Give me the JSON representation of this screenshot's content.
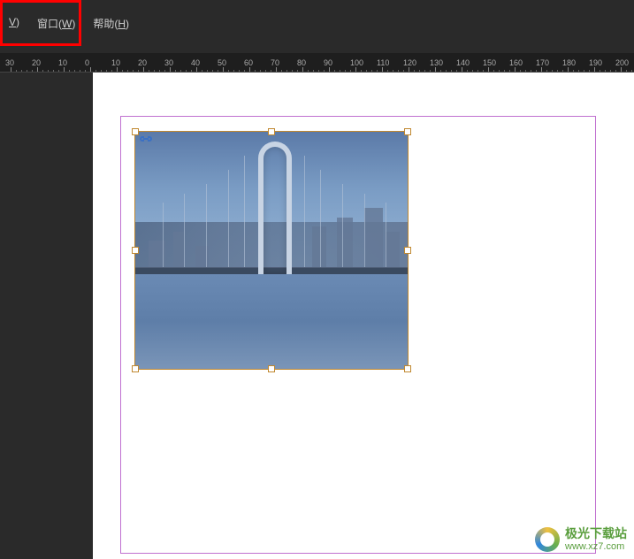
{
  "menubar": {
    "items": [
      {
        "prefix": "",
        "mnemonic": "V",
        "suffix": ")"
      },
      {
        "prefix": "窗口(",
        "mnemonic": "W",
        "suffix": ")"
      },
      {
        "prefix": "帮助(",
        "mnemonic": "H",
        "suffix": ")"
      }
    ]
  },
  "ruler": {
    "ticks": [
      "30",
      "20",
      "10",
      "0",
      "10",
      "20",
      "30",
      "40",
      "50",
      "60",
      "70",
      "80",
      "90",
      "100",
      "110",
      "120",
      "130",
      "140",
      "150",
      "160",
      "170",
      "180",
      "190",
      "200"
    ]
  },
  "canvas": {
    "selection": {
      "link_icon": "link-icon"
    }
  },
  "watermark": {
    "title": "极光下载站",
    "url": "www.xz7.com"
  },
  "colors": {
    "bg_dark": "#2a2a2a",
    "canvas_bg": "#ffffff",
    "doc_border": "#c070d0",
    "selection_border": "#c08830",
    "highlight": "#ff0000"
  }
}
